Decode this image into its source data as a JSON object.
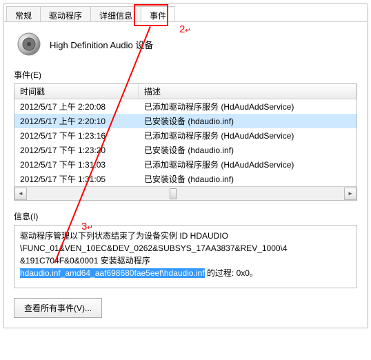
{
  "tabs": {
    "t0": "常规",
    "t1": "驱动程序",
    "t2": "详细信息",
    "t3": "事件"
  },
  "device_name": "High Definition Audio 设备",
  "events_label": "事件(E)",
  "columns": {
    "c0": "时间戳",
    "c1": "描述"
  },
  "rows": [
    {
      "t": "2012/5/17 上午 2:20:08",
      "d": "已添加驱动程序服务 (HdAudAddService)"
    },
    {
      "t": "2012/5/17 上午 2:20:10",
      "d": "已安装设备 (hdaudio.inf)"
    },
    {
      "t": "2012/5/17 下午 1:23:16",
      "d": "已添加驱动程序服务 (HdAudAddService)"
    },
    {
      "t": "2012/5/17 下午 1:23:20",
      "d": "已安装设备 (hdaudio.inf)"
    },
    {
      "t": "2012/5/17 下午 1:31:03",
      "d": "已添加驱动程序服务 (HdAudAddService)"
    },
    {
      "t": "2012/5/17 下午 1:31:05",
      "d": "已安装设备 (hdaudio.inf)"
    }
  ],
  "info_label": "信息(I)",
  "info_line1": "驱动程序管理以下列状态结束了为设备实例 ID HDAUDIO",
  "info_line2": "\\FUNC_01&VEN_10EC&DEV_0262&SUBSYS_17AA3837&REV_1000\\4",
  "info_line3_a": "&191C704F&0&0001 安装驱动程序",
  "info_hl": "hdaudio.inf_amd64_aaf698680fae5eef\\hdaudio.inf",
  "info_line3_b": " 的过程: 0x0。",
  "view_all_btn": "查看所有事件(V)...",
  "annotations": {
    "a2": "2",
    "a3": "3"
  }
}
